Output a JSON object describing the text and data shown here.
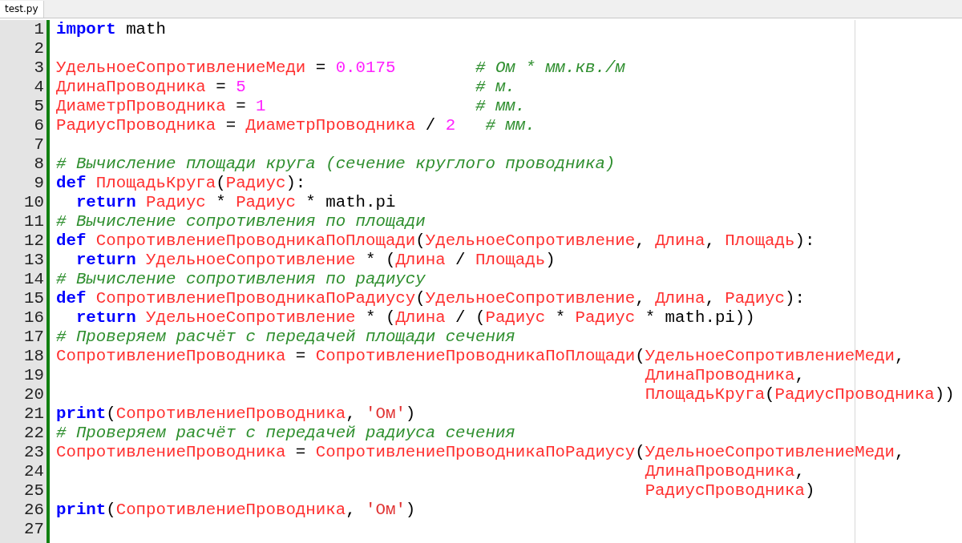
{
  "tabs": [
    {
      "label": "test.py",
      "selected": true
    }
  ],
  "lines": [
    {
      "number": "1",
      "tokens": [
        {
          "kind": "keyword",
          "text": "import"
        },
        {
          "kind": "plain",
          "text": " math"
        }
      ]
    },
    {
      "number": "2"
    },
    {
      "number": "3",
      "tokens": [
        {
          "kind": "ident",
          "text": "УдельноеСопротивлениеМеди"
        },
        {
          "kind": "plain",
          "text": " = "
        },
        {
          "kind": "number",
          "text": "0.0175"
        },
        {
          "kind": "comment",
          "text": "        # Ом * мм.кв./м"
        }
      ]
    },
    {
      "number": "4",
      "tokens": [
        {
          "kind": "ident",
          "text": "ДлинаПроводника"
        },
        {
          "kind": "plain",
          "text": " = "
        },
        {
          "kind": "number",
          "text": "5"
        },
        {
          "kind": "comment",
          "text": "                       # м."
        }
      ]
    },
    {
      "number": "5",
      "tokens": [
        {
          "kind": "ident",
          "text": "ДиаметрПроводника"
        },
        {
          "kind": "plain",
          "text": " = "
        },
        {
          "kind": "number",
          "text": "1"
        },
        {
          "kind": "comment",
          "text": "                     # мм."
        }
      ]
    },
    {
      "number": "6",
      "tokens": [
        {
          "kind": "ident",
          "text": "РадиусПроводника"
        },
        {
          "kind": "plain",
          "text": " = "
        },
        {
          "kind": "ident",
          "text": "ДиаметрПроводника"
        },
        {
          "kind": "plain",
          "text": " / "
        },
        {
          "kind": "number",
          "text": "2"
        },
        {
          "kind": "comment",
          "text": "   # мм."
        }
      ]
    },
    {
      "number": "7"
    },
    {
      "number": "8",
      "tokens": [
        {
          "kind": "comment",
          "text": "# Вычисление площади круга (сечение круглого проводника)"
        }
      ]
    },
    {
      "number": "9",
      "tokens": [
        {
          "kind": "keyword",
          "text": "def"
        },
        {
          "kind": "ident",
          "text": " ПлощадьКруга"
        },
        {
          "kind": "plain",
          "text": "("
        },
        {
          "kind": "ident",
          "text": "Радиус"
        },
        {
          "kind": "plain",
          "text": "):"
        }
      ]
    },
    {
      "number": "10",
      "tokens": [
        {
          "kind": "keyword",
          "text": "  return"
        },
        {
          "kind": "ident",
          "text": " Радиус"
        },
        {
          "kind": "plain",
          "text": " * "
        },
        {
          "kind": "ident",
          "text": "Радиус"
        },
        {
          "kind": "plain",
          "text": " * math.pi"
        }
      ]
    },
    {
      "number": "11",
      "tokens": [
        {
          "kind": "comment",
          "text": "# Вычисление сопротивления по площади"
        }
      ]
    },
    {
      "number": "12",
      "tokens": [
        {
          "kind": "keyword",
          "text": "def"
        },
        {
          "kind": "ident",
          "text": " СопротивлениеПроводникаПоПлощади"
        },
        {
          "kind": "plain",
          "text": "("
        },
        {
          "kind": "ident",
          "text": "УдельноеСопротивление"
        },
        {
          "kind": "plain",
          "text": ", "
        },
        {
          "kind": "ident",
          "text": "Длина"
        },
        {
          "kind": "plain",
          "text": ", "
        },
        {
          "kind": "ident",
          "text": "Площадь"
        },
        {
          "kind": "plain",
          "text": "):"
        }
      ]
    },
    {
      "number": "13",
      "tokens": [
        {
          "kind": "keyword",
          "text": "  return"
        },
        {
          "kind": "ident",
          "text": " УдельноеСопротивление"
        },
        {
          "kind": "plain",
          "text": " * ("
        },
        {
          "kind": "ident",
          "text": "Длина"
        },
        {
          "kind": "plain",
          "text": " / "
        },
        {
          "kind": "ident",
          "text": "Площадь"
        },
        {
          "kind": "plain",
          "text": ")"
        }
      ]
    },
    {
      "number": "14",
      "tokens": [
        {
          "kind": "comment",
          "text": "# Вычисление сопротивления по радиусу"
        }
      ]
    },
    {
      "number": "15",
      "tokens": [
        {
          "kind": "keyword",
          "text": "def"
        },
        {
          "kind": "ident",
          "text": " СопротивлениеПроводникаПоРадиусу"
        },
        {
          "kind": "plain",
          "text": "("
        },
        {
          "kind": "ident",
          "text": "УдельноеСопротивление"
        },
        {
          "kind": "plain",
          "text": ", "
        },
        {
          "kind": "ident",
          "text": "Длина"
        },
        {
          "kind": "plain",
          "text": ", "
        },
        {
          "kind": "ident",
          "text": "Радиус"
        },
        {
          "kind": "plain",
          "text": "):"
        }
      ]
    },
    {
      "number": "16",
      "tokens": [
        {
          "kind": "keyword",
          "text": "  return"
        },
        {
          "kind": "ident",
          "text": " УдельноеСопротивление"
        },
        {
          "kind": "plain",
          "text": " * ("
        },
        {
          "kind": "ident",
          "text": "Длина"
        },
        {
          "kind": "plain",
          "text": " / ("
        },
        {
          "kind": "ident",
          "text": "Радиус"
        },
        {
          "kind": "plain",
          "text": " * "
        },
        {
          "kind": "ident",
          "text": "Радиус"
        },
        {
          "kind": "plain",
          "text": " * math.pi))"
        }
      ]
    },
    {
      "number": "17",
      "tokens": [
        {
          "kind": "comment",
          "text": "# Проверяем расчёт с передачей площади сечения"
        }
      ]
    },
    {
      "number": "18",
      "tokens": [
        {
          "kind": "ident",
          "text": "СопротивлениеПроводника"
        },
        {
          "kind": "plain",
          "text": " = "
        },
        {
          "kind": "ident",
          "text": "СопротивлениеПроводникаПоПлощади"
        },
        {
          "kind": "plain",
          "text": "("
        },
        {
          "kind": "ident",
          "text": "УдельноеСопротивлениеМеди"
        },
        {
          "kind": "plain",
          "text": ","
        }
      ]
    },
    {
      "number": "19",
      "tokens": [
        {
          "kind": "ident",
          "text": "                                                           ДлинаПроводника"
        },
        {
          "kind": "plain",
          "text": ","
        }
      ]
    },
    {
      "number": "20",
      "tokens": [
        {
          "kind": "ident",
          "text": "                                                           ПлощадьКруга"
        },
        {
          "kind": "plain",
          "text": "("
        },
        {
          "kind": "ident",
          "text": "РадиусПроводника"
        },
        {
          "kind": "plain",
          "text": "))"
        }
      ]
    },
    {
      "number": "21",
      "tokens": [
        {
          "kind": "keyword",
          "text": "print"
        },
        {
          "kind": "plain",
          "text": "("
        },
        {
          "kind": "ident",
          "text": "СопротивлениеПроводника"
        },
        {
          "kind": "plain",
          "text": ", "
        },
        {
          "kind": "string",
          "text": "'Ом'"
        },
        {
          "kind": "plain",
          "text": ")"
        }
      ]
    },
    {
      "number": "22",
      "tokens": [
        {
          "kind": "comment",
          "text": "# Проверяем расчёт с передачей радиуса сечения"
        }
      ]
    },
    {
      "number": "23",
      "tokens": [
        {
          "kind": "ident",
          "text": "СопротивлениеПроводника"
        },
        {
          "kind": "plain",
          "text": " = "
        },
        {
          "kind": "ident",
          "text": "СопротивлениеПроводникаПоРадиусу"
        },
        {
          "kind": "plain",
          "text": "("
        },
        {
          "kind": "ident",
          "text": "УдельноеСопротивлениеМеди"
        },
        {
          "kind": "plain",
          "text": ","
        }
      ]
    },
    {
      "number": "24",
      "tokens": [
        {
          "kind": "ident",
          "text": "                                                           ДлинаПроводника"
        },
        {
          "kind": "plain",
          "text": ","
        }
      ]
    },
    {
      "number": "25",
      "tokens": [
        {
          "kind": "ident",
          "text": "                                                           РадиусПроводника"
        },
        {
          "kind": "plain",
          "text": ")"
        }
      ]
    },
    {
      "number": "26",
      "tokens": [
        {
          "kind": "keyword",
          "text": "print"
        },
        {
          "kind": "plain",
          "text": "("
        },
        {
          "kind": "ident",
          "text": "СопротивлениеПроводника"
        },
        {
          "kind": "plain",
          "text": ", "
        },
        {
          "kind": "string",
          "text": "'Ом'"
        },
        {
          "kind": "plain",
          "text": ")"
        }
      ]
    },
    {
      "number": "27"
    }
  ]
}
